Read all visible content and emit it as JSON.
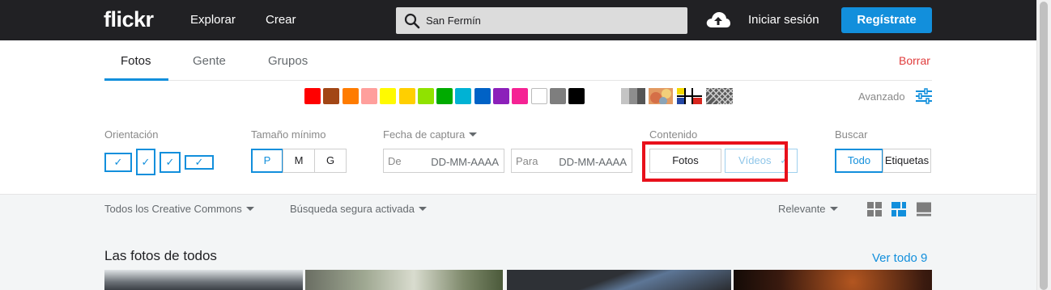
{
  "header": {
    "logo": "flickr",
    "nav": [
      "Explorar",
      "Crear"
    ],
    "search": {
      "value": "San Fermín",
      "icon": "search-icon"
    },
    "upload_icon": "cloud-upload-icon",
    "login": "Iniciar sesión",
    "signup": "Regístrate"
  },
  "tabs": {
    "items": [
      "Fotos",
      "Gente",
      "Grupos"
    ],
    "active": "Fotos",
    "clear": "Borrar"
  },
  "colors": {
    "swatches": [
      "#ff0000",
      "#a24615",
      "#ff7c00",
      "#ff9f9c",
      "#fffa00",
      "#ffcf00",
      "#90e200",
      "#00ab00",
      "#00b2d4",
      "#0062c6",
      "#8c20ba",
      "#f52394",
      "#ffffff",
      "#7e7e7e",
      "#000000"
    ],
    "style_icons": [
      "black-white-style-icon",
      "shallow-depth-style-icon",
      "minimalist-style-icon",
      "pattern-style-icon"
    ],
    "advanced_label": "Avanzado",
    "accent": "#128fdc"
  },
  "filters": {
    "orientation": {
      "label": "Orientación"
    },
    "min_size": {
      "label": "Tamaño mínimo",
      "options": [
        "P",
        "M",
        "G"
      ],
      "selected": "P"
    },
    "date": {
      "label": "Fecha de captura",
      "from_label": "De",
      "to_label": "Para",
      "placeholder": "DD-MM-AAAA"
    },
    "content": {
      "label": "Contenido",
      "options": [
        "Fotos",
        "Vídeos"
      ]
    },
    "search_in": {
      "label": "Buscar",
      "options": [
        "Todo",
        "Etiquetas"
      ],
      "selected": "Todo"
    }
  },
  "toolbar": {
    "license": "Todos los Creative Commons",
    "safe_search": "Búsqueda segura activada",
    "sort": "Relevante",
    "view_icons": [
      "grid-view-icon",
      "justified-view-icon",
      "single-view-icon"
    ]
  },
  "results": {
    "title": "Las fotos de todos",
    "see_all": "Ver todo 9"
  }
}
